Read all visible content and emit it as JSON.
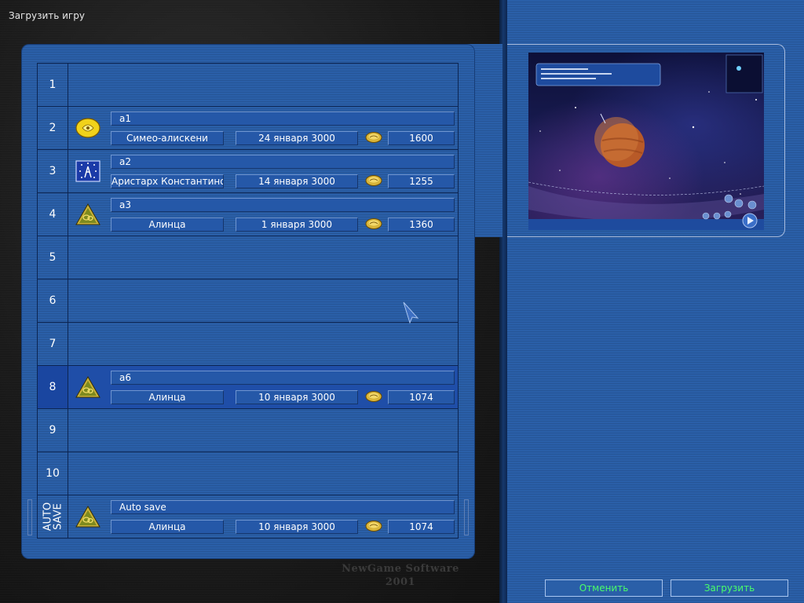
{
  "screen": {
    "title": "Загрузить игру"
  },
  "slots": [
    {
      "number": "1",
      "empty": true
    },
    {
      "number": "2",
      "empty": false,
      "icon": "gold-emblem-icon",
      "name": "a1",
      "player": "Симео-алискени",
      "date": "24 января 3000",
      "money": "1600"
    },
    {
      "number": "3",
      "empty": false,
      "icon": "blue-star-emblem-icon",
      "name": "a2",
      "player": "Аристарх Константинов",
      "date": "14 января 3000",
      "money": "1255"
    },
    {
      "number": "4",
      "empty": false,
      "icon": "green-triangle-emblem-icon",
      "name": "a3",
      "player": "Алинца",
      "date": "1 января 3000",
      "money": "1360"
    },
    {
      "number": "5",
      "empty": true
    },
    {
      "number": "6",
      "empty": true
    },
    {
      "number": "7",
      "empty": true
    },
    {
      "number": "8",
      "empty": false,
      "selected": true,
      "icon": "green-triangle-emblem-icon",
      "name": "a6",
      "player": "Алинца",
      "date": "10 января 3000",
      "money": "1074"
    },
    {
      "number": "9",
      "empty": true
    },
    {
      "number": "10",
      "empty": true
    }
  ],
  "autosave": {
    "label_line1": "AUTO",
    "label_line2": "SAVE",
    "icon": "green-triangle-emblem-icon",
    "name": "Auto save",
    "player": "Алинца",
    "date": "10 января 3000",
    "money": "1074"
  },
  "watermark": {
    "line1": "NewGame Software",
    "line2": "2001"
  },
  "buttons": {
    "cancel": "Отменить",
    "load": "Загрузить"
  },
  "colors": {
    "panel_blue": "#2a5fa8",
    "selected_row": "#1a46a0",
    "button_text": "#49ff6a"
  }
}
